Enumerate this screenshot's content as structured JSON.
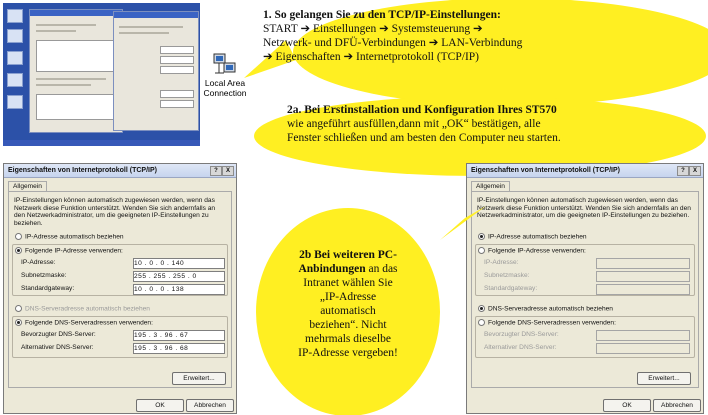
{
  "desktop_icon_label": "Local Area Connection",
  "bubble1": {
    "heading": "1. So gelangen Sie zu den TCP/IP-Einstellungen:",
    "line2": "START ➔ Einstellungen ➔ Systemsteuerung ➔",
    "line3": "Netzwerk- und DFÜ-Verbindungen ➔ LAN-Verbindung",
    "line4": "➔ Eigenschaften ➔ Internetprotokoll (TCP/IP)"
  },
  "bubble2a": {
    "heading": "2a. Bei Erstinstallation und Konfiguration Ihres ST570",
    "line2": "wie angeführt ausfüllen,dann mit „OK“ bestätigen, alle",
    "line3": "Fenster schließen und  am besten den Computer neu starten."
  },
  "bubble2b": {
    "l1": "2b Bei weiteren PC-",
    "l2": "Anbindungen",
    "l2b": " an das",
    "l3": "Intranet wählen Sie",
    "l4": "„IP-Adresse",
    "l5": "automatisch",
    "l6": "beziehen“. Nicht",
    "l7": "mehrmals dieselbe",
    "l8": "IP-Adresse vergeben!"
  },
  "dialog": {
    "title": "Eigenschaften von Internetprotokoll (TCP/IP)",
    "help_btn": "?",
    "close_btn": "X",
    "tab": "Allgemein",
    "intro": "IP-Einstellungen können automatisch zugewiesen werden, wenn das Netzwerk diese Funktion unterstützt. Wenden Sie sich andernfalls an den Netzwerkadministrator, um die geeigneten IP-Einstellungen zu beziehen.",
    "radio_auto_ip": "IP-Adresse automatisch beziehen",
    "radio_manual_ip": "Folgende IP-Adresse verwenden:",
    "label_ip": "IP-Adresse:",
    "label_mask": "Subnetzmaske:",
    "label_gw": "Standardgateway:",
    "radio_auto_dns": "DNS-Serveradresse automatisch beziehen",
    "radio_manual_dns": "Folgende DNS-Serveradressen verwenden:",
    "label_dns1": "Bevorzugter DNS-Server:",
    "label_dns2": "Alternativer DNS-Server:",
    "advanced_btn": "Erweitert...",
    "ok_btn": "OK",
    "cancel_btn": "Abbrechen"
  },
  "left_values": {
    "ip": "10 .  0 .  0 . 140",
    "mask": "255 . 255 . 255 .  0",
    "gw": "10 .  0 .  0 . 138",
    "dns1": "195 .  3 .  96 .  67",
    "dns2": "195 .  3 .  96 .  68"
  }
}
